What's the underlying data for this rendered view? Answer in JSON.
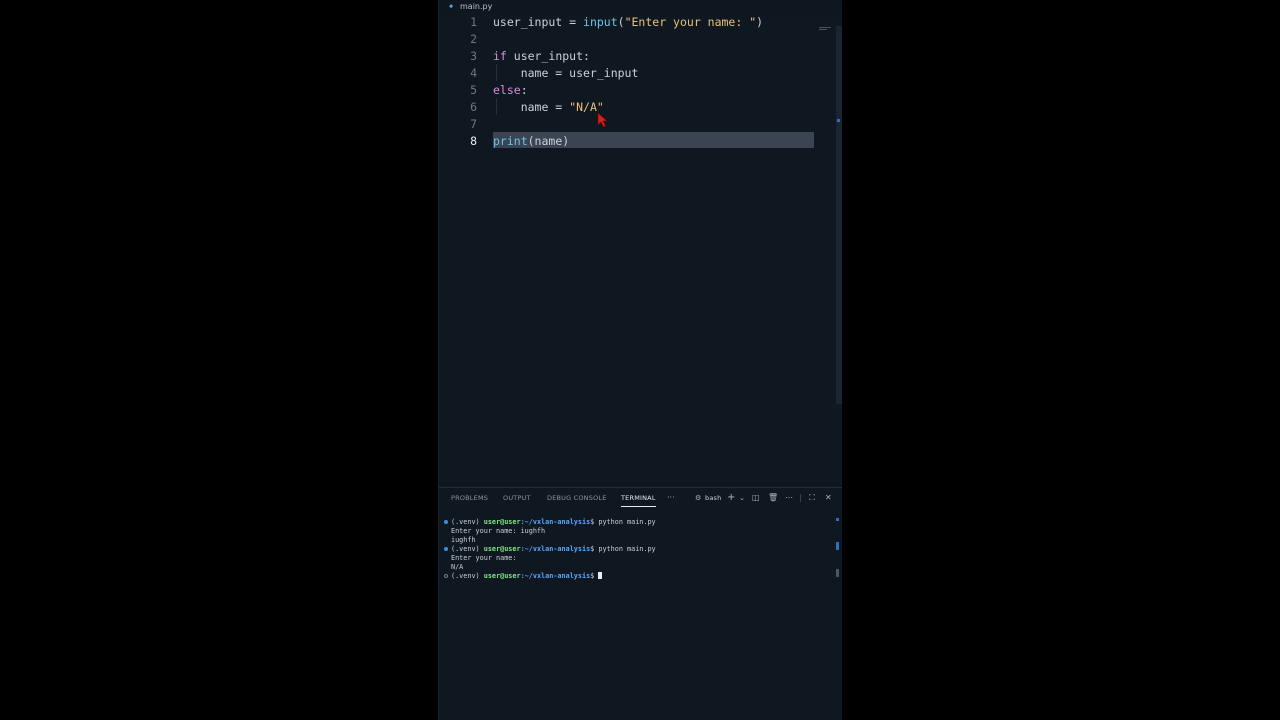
{
  "tab": {
    "filename": "main.py",
    "icon": "python-file-icon"
  },
  "editor": {
    "lines": [
      {
        "num": "1",
        "tokens": [
          {
            "t": "user_input = ",
            "c": "id"
          },
          {
            "t": "input",
            "c": "fn"
          },
          {
            "t": "(",
            "c": "id"
          },
          {
            "t": "\"Enter your name: \"",
            "c": "str"
          },
          {
            "t": ")",
            "c": "id"
          }
        ]
      },
      {
        "num": "2",
        "tokens": []
      },
      {
        "num": "3",
        "tokens": [
          {
            "t": "if",
            "c": "kw"
          },
          {
            "t": " user_input:",
            "c": "id"
          }
        ]
      },
      {
        "num": "4",
        "tokens": [
          {
            "t": "    name = user_input",
            "c": "id"
          }
        ]
      },
      {
        "num": "5",
        "tokens": [
          {
            "t": "else",
            "c": "kw"
          },
          {
            "t": ":",
            "c": "id"
          }
        ]
      },
      {
        "num": "6",
        "tokens": [
          {
            "t": "    name = ",
            "c": "id"
          },
          {
            "t": "\"N/A\"",
            "c": "str"
          }
        ]
      },
      {
        "num": "7",
        "tokens": []
      },
      {
        "num": "8",
        "tokens": [
          {
            "t": "print",
            "c": "fn"
          },
          {
            "t": "(name)",
            "c": "id"
          }
        ]
      }
    ],
    "active_line": "8"
  },
  "panel": {
    "tabs": [
      "PROBLEMS",
      "OUTPUT",
      "DEBUG CONSOLE",
      "TERMINAL"
    ],
    "active_tab": "TERMINAL",
    "more": "···",
    "shell": "bash",
    "icons": [
      "add-terminal-icon",
      "dropdown-icon",
      "split-terminal-icon",
      "trash-icon",
      "more-actions-icon",
      "maximize-panel-icon",
      "close-panel-icon"
    ]
  },
  "terminal": {
    "prompt_env": "(.venv) ",
    "prompt_user": "user@user",
    "prompt_path": ":~/vxlan-analysis",
    "prompt_sym": "$ ",
    "cmd1": "python main.py",
    "out1a": "Enter your name: iughfh",
    "out1b": "iughfh",
    "cmd2": "python main.py",
    "out2a": "Enter your name:",
    "out2b": "N/A"
  },
  "colors": {
    "keyword": "#d58fd5",
    "function": "#6cc4e6",
    "string": "#e8c07a",
    "accent": "#3b8ed8"
  }
}
